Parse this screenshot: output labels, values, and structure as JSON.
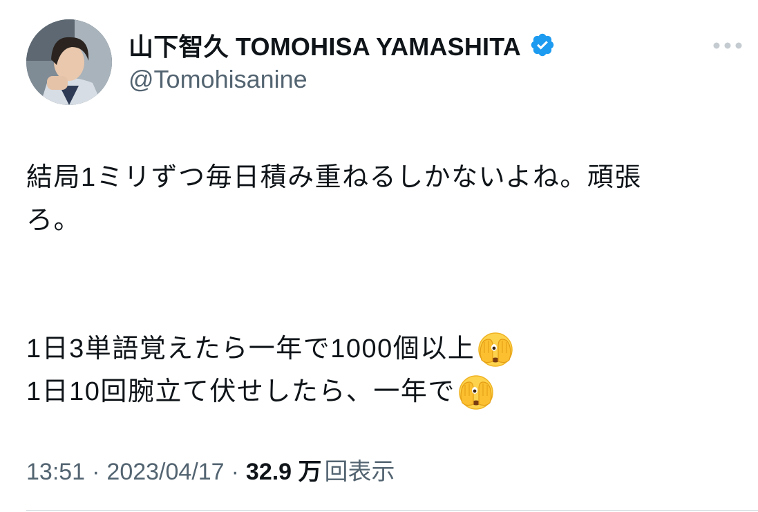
{
  "author": {
    "display_name": "山下智久 TOMOHISA YAMASHITA",
    "handle": "@Tomohisanine",
    "verified_color": "#1d9bf0"
  },
  "tweet": {
    "line1": "結局1ミリずつ毎日積み重ねるしかないよね。頑張",
    "line2": "ろ。",
    "line3": "1日3単語覚えたら一年で1000個以上",
    "line4": "1日10回腕立て伏せしたら、一年で",
    "emoji_icon": "face-with-peeking-eye"
  },
  "meta": {
    "time": "13:51",
    "separator": "·",
    "date": "2023/04/17",
    "views_count": "32.9 万",
    "views_label": "回表示"
  },
  "icons": {
    "more": "ellipsis-horizontal-icon",
    "verified": "verified-badge-icon"
  }
}
